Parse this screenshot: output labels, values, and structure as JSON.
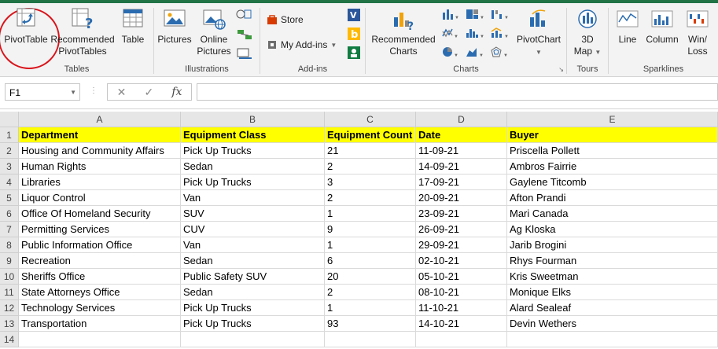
{
  "ribbon": {
    "groups": {
      "tables": "Tables",
      "illustrations": "Illustrations",
      "addins": "Add-ins",
      "charts": "Charts",
      "tours": "Tours",
      "sparklines": "Sparklines"
    },
    "buttons": {
      "pivottable": "PivotTable",
      "recommended_pivot_1": "Recommended",
      "recommended_pivot_2": "PivotTables",
      "table": "Table",
      "pictures": "Pictures",
      "online_pictures_1": "Online",
      "online_pictures_2": "Pictures",
      "store": "Store",
      "my_addins": "My Add-ins",
      "recommended_charts_1": "Recommended",
      "recommended_charts_2": "Charts",
      "pivotchart": "PivotChart",
      "map3d_1": "3D",
      "map3d_2": "Map",
      "line": "Line",
      "column": "Column",
      "winloss_1": "Win/",
      "winloss_2": "Loss"
    },
    "colors": {
      "accent": "#217346",
      "highlight_circle": "#d9141b"
    }
  },
  "formula_bar": {
    "name_box": "F1",
    "fx_label": "fx",
    "cancel_symbol": "✕",
    "enter_symbol": "✓",
    "value": ""
  },
  "sheet": {
    "columns": [
      "A",
      "B",
      "C",
      "D",
      "E"
    ],
    "rows": [
      "1",
      "2",
      "3",
      "4",
      "5",
      "6",
      "7",
      "8",
      "9",
      "10",
      "11",
      "12",
      "13",
      "14"
    ],
    "header": [
      "Department",
      "Equipment Class",
      "Equipment Count",
      "Date",
      "Buyer"
    ],
    "data": [
      [
        "Housing and Community Affairs",
        "Pick Up Trucks",
        "21",
        "11-09-21",
        "Priscella Pollett"
      ],
      [
        "Human Rights",
        "Sedan",
        "2",
        "14-09-21",
        "Ambros Fairrie"
      ],
      [
        "Libraries",
        "Pick Up Trucks",
        "3",
        "17-09-21",
        "Gaylene Titcomb"
      ],
      [
        "Liquor Control",
        "Van",
        "2",
        "20-09-21",
        "Afton Prandi"
      ],
      [
        "Office Of Homeland Security",
        "SUV",
        "1",
        "23-09-21",
        "Mari Canada"
      ],
      [
        "Permitting Services",
        "CUV",
        "9",
        "26-09-21",
        "Ag Kloska"
      ],
      [
        "Public Information Office",
        "Van",
        "1",
        "29-09-21",
        "Jarib Brogini"
      ],
      [
        "Recreation",
        "Sedan",
        "6",
        "02-10-21",
        "Rhys Fourman"
      ],
      [
        "Sheriffs Office",
        "Public Safety SUV",
        "20",
        "05-10-21",
        "Kris Sweetman"
      ],
      [
        "State Attorneys Office",
        "Sedan",
        "2",
        "08-10-21",
        "Monique Elks"
      ],
      [
        "Technology Services",
        "Pick Up Trucks",
        "1",
        "11-10-21",
        "Alard Sealeaf"
      ],
      [
        "Transportation",
        "Pick Up Trucks",
        "93",
        "14-10-21",
        "Devin Wethers"
      ],
      [
        "",
        "",
        "",
        "",
        ""
      ]
    ],
    "header_fill": "#ffff00"
  }
}
